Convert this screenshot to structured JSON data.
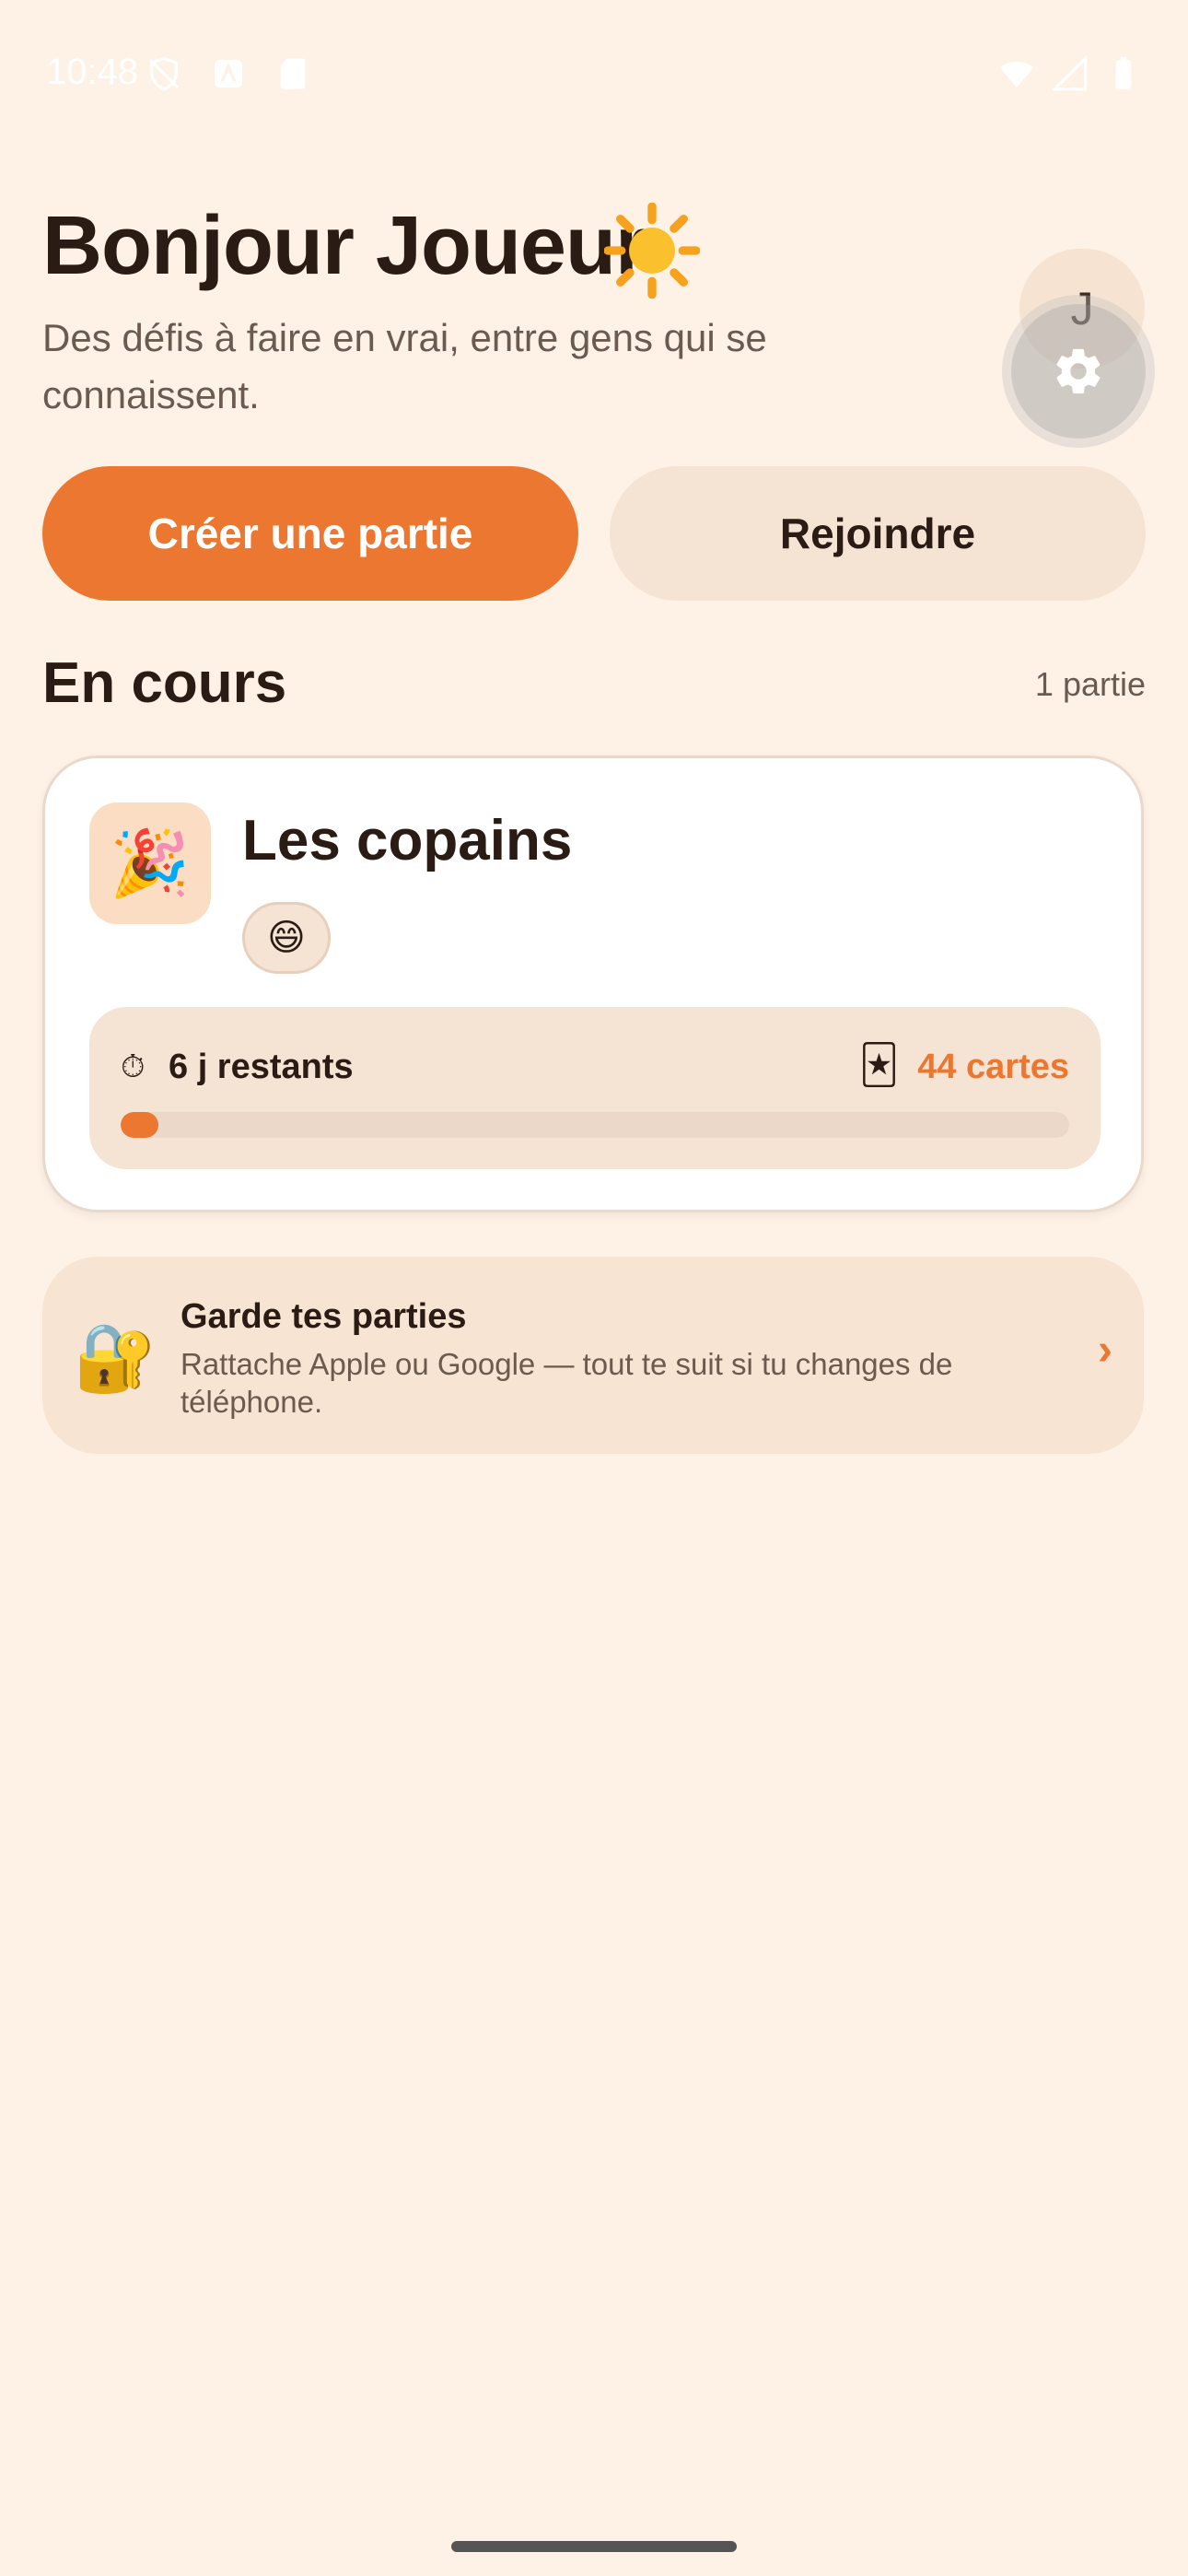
{
  "status_bar": {
    "time": "10:48"
  },
  "header": {
    "greeting": "Bonjour Joueur",
    "greeting_emoji": "☀️",
    "subtitle": "Des défis à faire en vrai, entre gens qui se connaissent.",
    "avatar_initial": "J"
  },
  "actions": {
    "create_label": "Créer une partie",
    "join_label": "Rejoindre"
  },
  "section": {
    "title": "En cours",
    "count": "1 partie"
  },
  "game": {
    "icon": "🎉",
    "name": "Les copains",
    "member_emoji": "😄",
    "timer_icon": "⏱",
    "time_left": "6 j restants",
    "cards_icon": "🃏",
    "cards_count": "44 cartes",
    "progress_percent": 4
  },
  "account_banner": {
    "icon": "🔐",
    "title": "Garde tes parties",
    "text": "Rattache Apple ou Google — tout te suit si tu changes de téléphone.",
    "chevron": "›"
  },
  "colors": {
    "background": "#FEF2E6",
    "accent": "#EB7730",
    "surface": "#F5E3D3",
    "text": "#2A1C14"
  }
}
